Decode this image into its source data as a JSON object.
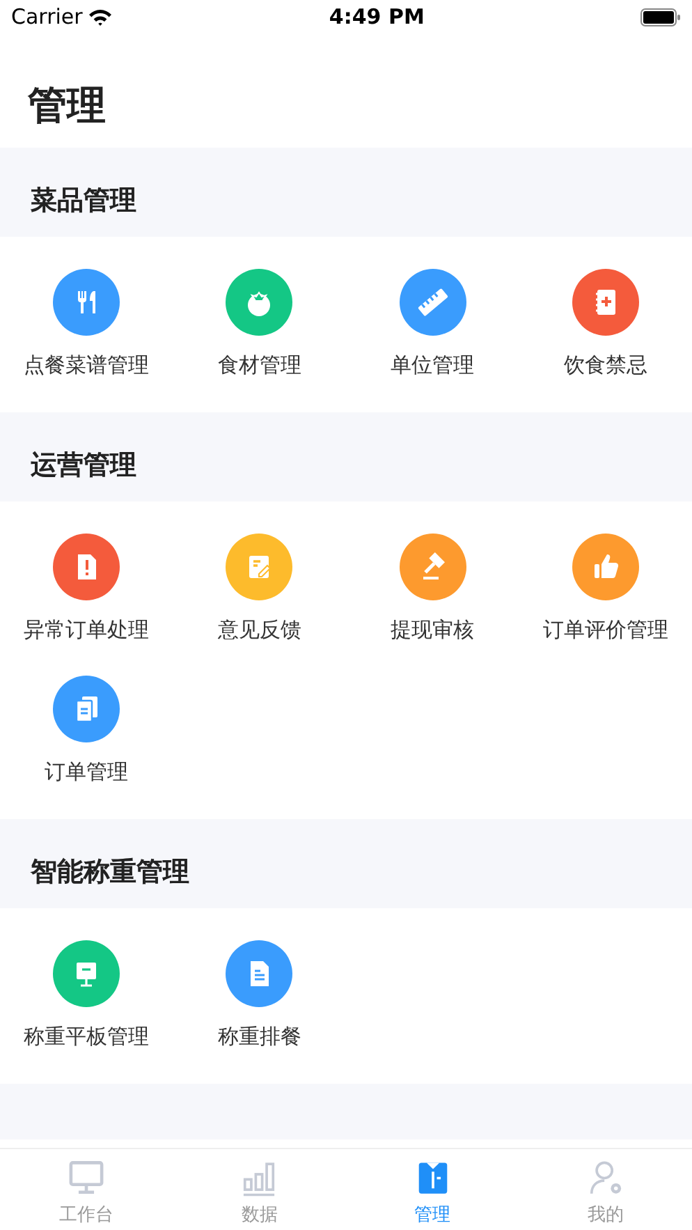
{
  "status_bar": {
    "carrier": "Carrier",
    "time": "4:49 PM"
  },
  "title": "管理",
  "sections": [
    {
      "title": "菜品管理",
      "items": [
        {
          "label": "点餐菜谱管理",
          "color": "#3a9cfd"
        },
        {
          "label": "食材管理",
          "color": "#14c785"
        },
        {
          "label": "单位管理",
          "color": "#3a9cfd"
        },
        {
          "label": "饮食禁忌",
          "color": "#f45b3c"
        }
      ]
    },
    {
      "title": "运营管理",
      "items": [
        {
          "label": "异常订单处理",
          "color": "#f45b3c"
        },
        {
          "label": "意见反馈",
          "color": "#fdbb2c"
        },
        {
          "label": "提现审核",
          "color": "#fd9a2e"
        },
        {
          "label": "订单评价管理",
          "color": "#fd9a2e"
        },
        {
          "label": "订单管理",
          "color": "#3a9cfd"
        }
      ]
    },
    {
      "title": "智能称重管理",
      "items": [
        {
          "label": "称重平板管理",
          "color": "#14c785"
        },
        {
          "label": "称重排餐",
          "color": "#3a9cfd"
        }
      ]
    }
  ],
  "tabs": [
    {
      "label": "工作台",
      "selected": false
    },
    {
      "label": "数据",
      "selected": false
    },
    {
      "label": "管理",
      "selected": true
    },
    {
      "label": "我的",
      "selected": false
    }
  ]
}
